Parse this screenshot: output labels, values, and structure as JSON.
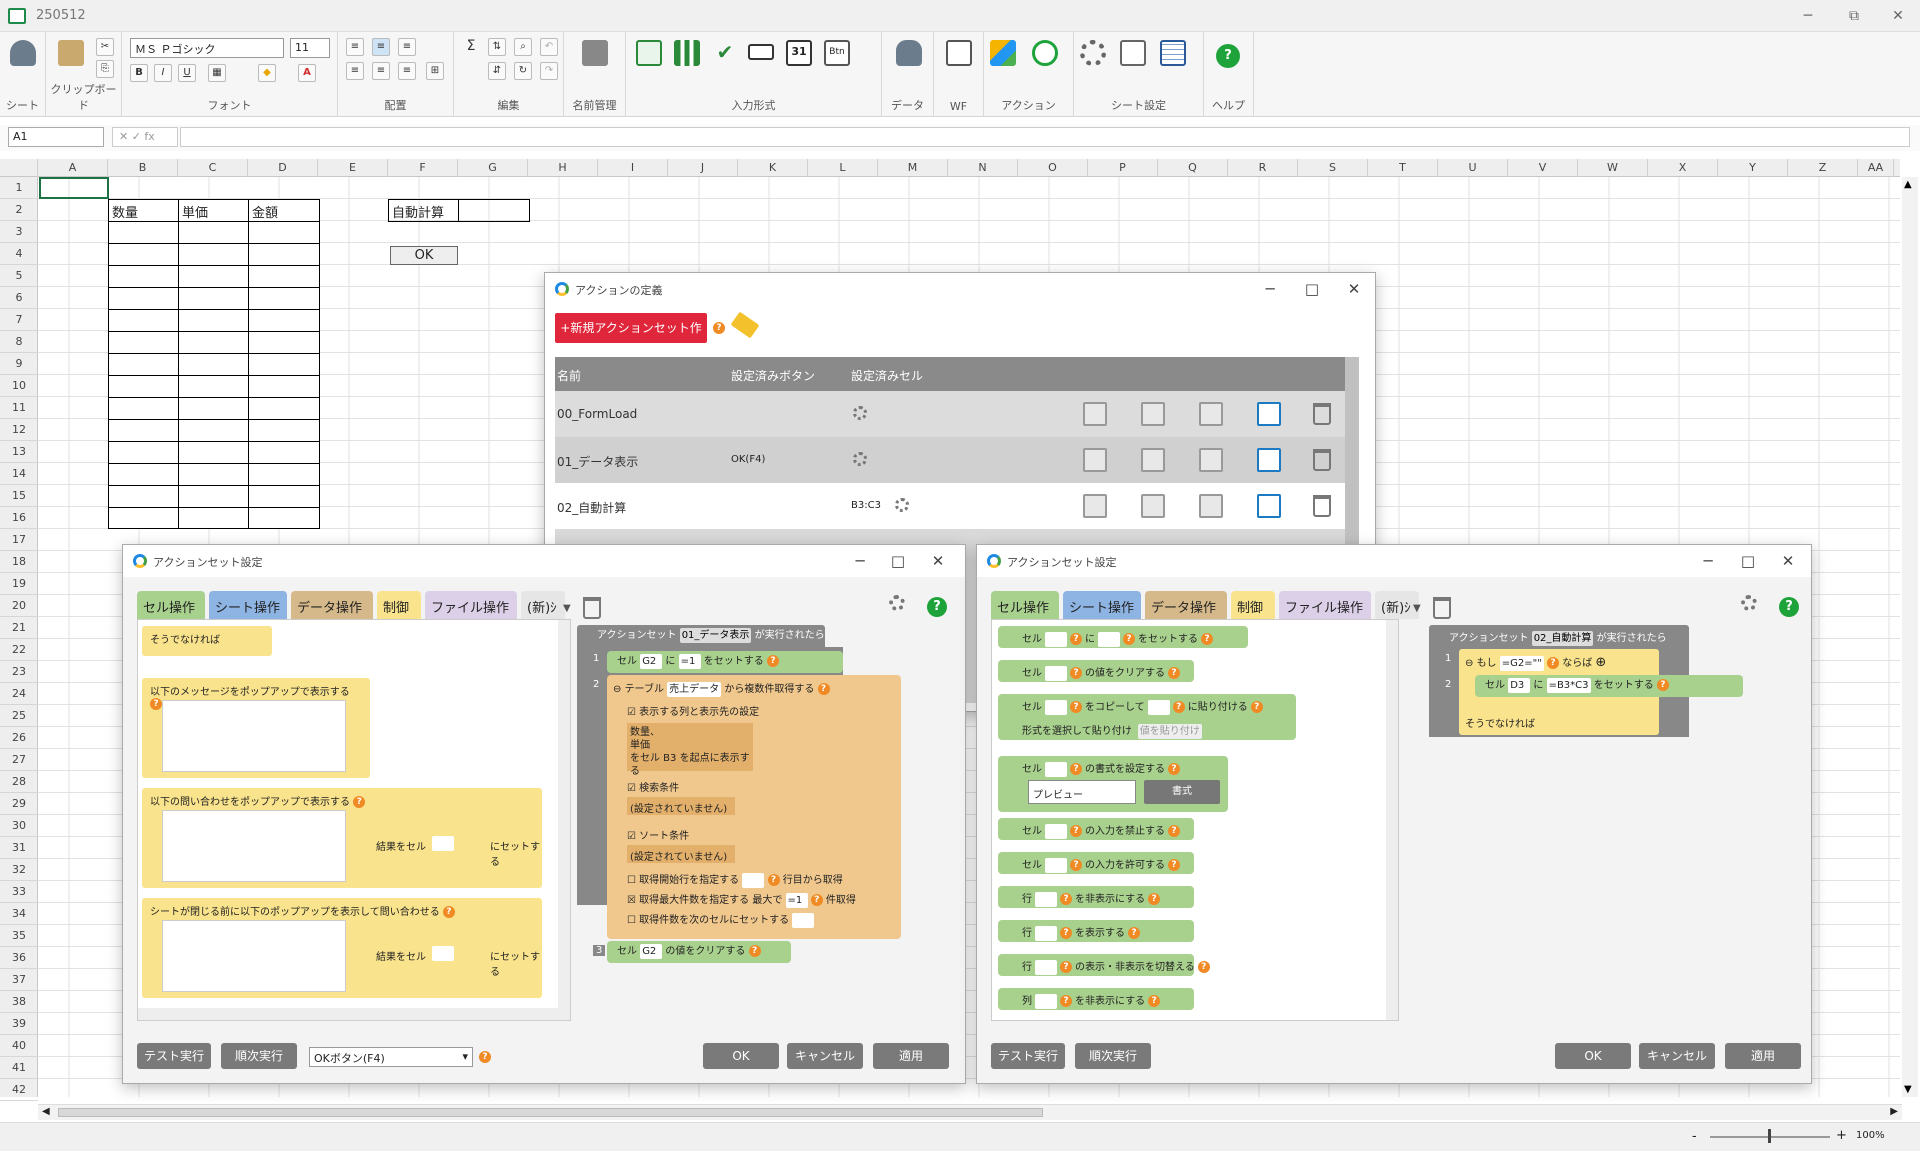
{
  "window": {
    "title": "250512",
    "min": "─",
    "max": "⧉",
    "close": "✕"
  },
  "ribbon": {
    "groups": [
      "シート",
      "クリップボード",
      "フォント",
      "配置",
      "編集",
      "名前管理",
      "入力形式",
      "データ",
      "WF",
      "アクション",
      "シート設定",
      "ヘルプ"
    ],
    "font_name": "ＭＳ Ｐゴシック",
    "font_size": "11",
    "bold": "B",
    "italic": "I",
    "underline": "U",
    "sigma": "Σ",
    "help": "?"
  },
  "formula_bar": {
    "namebox": "A1",
    "fx": "✕ ✓ fx",
    "value": ""
  },
  "columns": [
    "A",
    "B",
    "C",
    "D",
    "E",
    "F",
    "G",
    "H",
    "I",
    "J",
    "K",
    "L",
    "M",
    "N",
    "O",
    "P",
    "Q",
    "R",
    "S",
    "T",
    "U",
    "V",
    "W",
    "X",
    "Y",
    "Z",
    "AA"
  ],
  "rows": [
    "1",
    "2",
    "3",
    "4",
    "5",
    "6",
    "7",
    "8",
    "9",
    "10",
    "11",
    "12",
    "13",
    "14",
    "15",
    "16",
    "17",
    "18",
    "19",
    "20",
    "21",
    "22",
    "23",
    "24",
    "25",
    "26",
    "27",
    "28",
    "29",
    "30",
    "31",
    "32",
    "33",
    "34",
    "35",
    "36",
    "37",
    "38",
    "39",
    "40",
    "41",
    "42"
  ],
  "sheet": {
    "b2": "数量",
    "c2": "単価",
    "d2": "金額",
    "f2": "自動計算",
    "ok": "OK"
  },
  "status": {
    "zoom": "100%",
    "minus": "-",
    "plus": "+"
  },
  "action_def": {
    "title": "アクションの定義",
    "new_button": "+新規アクションセット作成",
    "headers": [
      "名前",
      "設定済みボタン",
      "設定済みセル"
    ],
    "rows": [
      {
        "name": "00_FormLoad",
        "button": "",
        "cell": ""
      },
      {
        "name": "01_データ表示",
        "button": "OK(F4)",
        "cell": ""
      },
      {
        "name": "02_自動計算",
        "button": "",
        "cell": "B3:C3"
      }
    ]
  },
  "left_dlg": {
    "title": "アクションセット設定",
    "tabs": [
      "セル操作",
      "シート操作",
      "データ操作",
      "制御",
      "ファイル操作",
      "(新)ｼ"
    ],
    "palette": [
      "そうでなければ",
      "以下のメッセージをポップアップで表示する",
      "以下の問い合わせをポップアップで表示する",
      "結果をセル",
      "にセットする",
      "シートが閉じる前に以下のポップアップを表示して問い合わせる",
      "結果をセル",
      "にセットする"
    ],
    "script": {
      "header_pre": "アクションセット",
      "header_name": "01_データ表示",
      "header_post": "が実行されたら",
      "l1": "1",
      "l1a": "セル",
      "l1b": "G2",
      "l1c": "に",
      "l1d": "=1",
      "l1e": "をセットする",
      "l2": "2",
      "l2a": "テーブル",
      "l2b": "売上データ",
      "l2c": "から複数件取得する",
      "cols_label": "表示する列と表示先の設定",
      "cols_value": "数量、\n単価\nをセル B3 を起点に表示する",
      "search_label": "検索条件",
      "search_value": "(設定されていません)",
      "sort_label": "ソート条件",
      "sort_value": "(設定されていません)",
      "start_label": "取得開始行を指定する",
      "start_post": "行目から取得",
      "max_label": "取得最大件数を指定する",
      "max_mid": "最大で",
      "max_val": "=1",
      "max_post": "件取得",
      "count_label": "取得件数を次のセルにセットする",
      "l3": "3",
      "l3a": "セル",
      "l3b": "G2",
      "l3c": "の値をクリアする"
    },
    "btn_test": "テスト実行",
    "btn_step": "順次実行",
    "select": "OKボタン(F4)",
    "ok": "OK",
    "cancel": "キャンセル",
    "apply": "適用"
  },
  "right_dlg": {
    "title": "アクションセット設定",
    "tabs": [
      "セル操作",
      "シート操作",
      "データ操作",
      "制御",
      "ファイル操作",
      "(新)ｼ"
    ],
    "palette": [
      {
        "a": "セル",
        "b": "に",
        "c": "をセットする"
      },
      {
        "a": "セル",
        "b": "の値をクリアする"
      },
      {
        "a": "セル",
        "b": "をコピーして",
        "c": "に貼り付ける"
      },
      {
        "a": "セル",
        "b": "の書式を設定する"
      },
      {
        "a": "セル",
        "b": "の入力を禁止する"
      },
      {
        "a": "セル",
        "b": "の入力を許可する"
      },
      {
        "a": "行",
        "b": "を非表示にする"
      },
      {
        "a": "行",
        "b": "を表示する"
      },
      {
        "a": "行",
        "b": "の表示・非表示を切替える"
      },
      {
        "a": "列",
        "b": "を非表示にする"
      }
    ],
    "paste_label": "形式を選択して貼り付け",
    "paste_select": "値を貼り付け",
    "preview": "プレビュー",
    "format_btn": "書式",
    "script": {
      "header_pre": "アクションセット",
      "header_name": "02_自動計算",
      "header_post": "が実行されたら",
      "l1": "1",
      "if": "もし",
      "cond": "=G2=\"\"",
      "then": "ならば",
      "l2": "2",
      "cell": "セル",
      "target": "D3",
      "ni": "に",
      "val": "=B3*C3",
      "set": "をセットする",
      "else": "そうでなければ"
    },
    "btn_test": "テスト実行",
    "btn_step": "順次実行",
    "ok": "OK",
    "cancel": "キャンセル",
    "apply": "適用"
  }
}
